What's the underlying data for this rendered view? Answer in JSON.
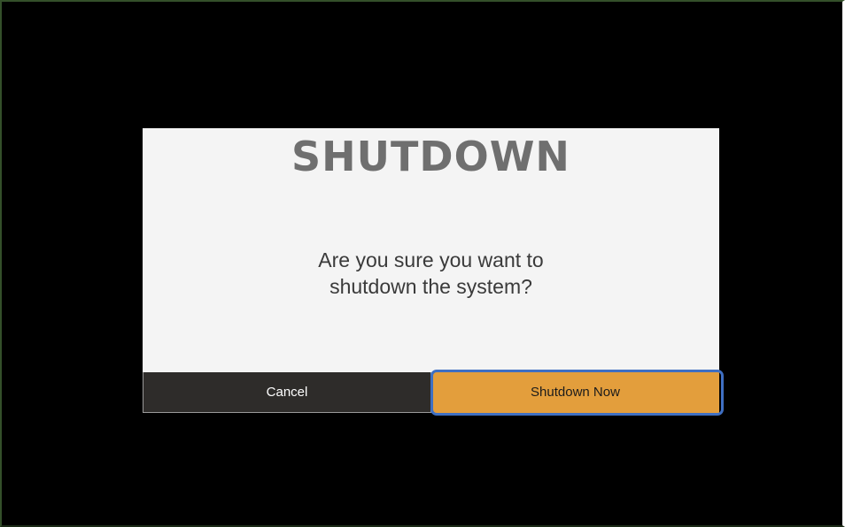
{
  "dialog": {
    "title": "SHUTDOWN",
    "message_line1": "Are you sure you want to",
    "message_line2": "shutdown the system?",
    "cancel_label": "Cancel",
    "confirm_label": "Shutdown Now",
    "focused_button": "confirm"
  },
  "colors": {
    "backdrop": "#000000",
    "dialog_bg": "#f4f4f4",
    "title": "#6f6f6f",
    "cancel_bg": "#2e2c2a",
    "confirm_bg": "#e39e3c",
    "focus_ring": "#3f6fc2"
  }
}
